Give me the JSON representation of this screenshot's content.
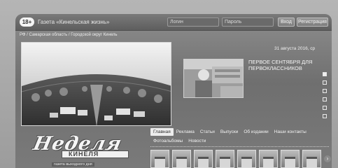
{
  "topbar": {
    "age_badge": "18+",
    "site_link": "Газета «Кинельская жизнь»",
    "login_placeholder": "Логин",
    "password_placeholder": "Пароль",
    "enter_label": "Вход",
    "register_label": "Регистрация"
  },
  "breadcrumb": "РФ / Самарская область / Городской округ Кинель",
  "date": "31 августа 2016, ср",
  "news": {
    "title": "ПЕРВОЕ СЕНТЯБРЯ ДЛЯ ПЕРВОКЛАССНИКОВ",
    "pager_count": 6,
    "pager_active": 0
  },
  "logo": {
    "word": "Неделя",
    "city": "КИНЕЛЯ",
    "subtitle": "газета выходного дня"
  },
  "nav": {
    "row1": [
      "Главная",
      "Реклама",
      "Статьи",
      "Выпуски",
      "Об издании",
      "Наши контакты"
    ],
    "row2": [
      "Фотоальбомы",
      "Новости"
    ],
    "active_index": 0
  },
  "thumbnails_count": 8,
  "thumbs_next": "›",
  "colors": {
    "page_bg": "#7a7a7a",
    "active_nav_bg": "#ececec"
  }
}
